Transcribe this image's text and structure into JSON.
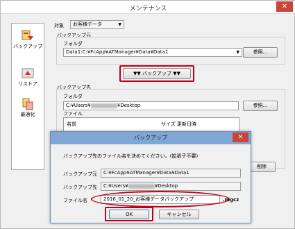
{
  "window": {
    "title": "メンテナンス",
    "close_glyph": "✕"
  },
  "sidebar": {
    "items": [
      {
        "label": "バックアップ",
        "icon": "backup-icon"
      },
      {
        "label": "リストア",
        "icon": "restore-icon"
      },
      {
        "label": "最適化",
        "icon": "optimize-icon"
      }
    ]
  },
  "target": {
    "label": "対象",
    "value": "お客様データ"
  },
  "source": {
    "group_label": "バックアップ元",
    "folder_label": "フォルダ",
    "folder_value": "Data1:C:¥FcApp¥ATManager¥Data¥Data1",
    "browse_label": "参照..."
  },
  "backup_button": {
    "label": "▼▼ バックアップ ▼▼"
  },
  "destination": {
    "group_label": "バックアップ先",
    "folder_label": "フォルダ",
    "folder_value_prefix": "C:¥Users¥",
    "folder_value_suffix": "¥Desktop",
    "browse_label": "参照...",
    "files_label": "ファイル",
    "columns": [
      "名前",
      "サイズ",
      "更新日時"
    ],
    "delete_label": "削除"
  },
  "dialog": {
    "title": "バックアップ",
    "close_glyph": "✕",
    "message": "バックアップ先のファイル名を決めてください。(拡張子不要)",
    "source_label": "バックアップ元",
    "source_value": "C:¥FcApp¥ATManager¥Data¥Data1",
    "dest_label": "バックアップ先",
    "dest_value_prefix": "C:¥Users¥",
    "dest_value_suffix": "¥Desktop",
    "filename_label": "ファイル名",
    "filename_value": "2016_01_20_お客様データバックアップ",
    "extension": ".mgcz",
    "ok_label": "OK",
    "cancel_label": "キャンセル"
  },
  "colors": {
    "highlight": "#c0001a",
    "dialog_title": "#7ea7d3",
    "close": "#c9453a"
  }
}
